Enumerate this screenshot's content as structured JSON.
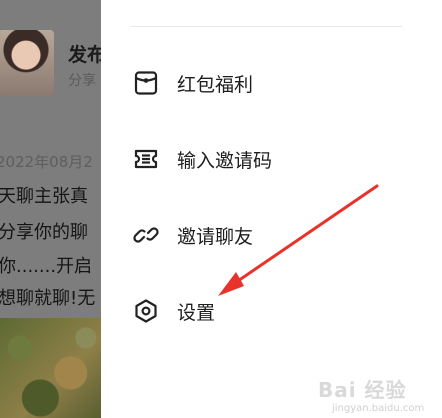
{
  "background": {
    "post_title": "发布",
    "post_subtitle": "分享",
    "date": "2022年08月2",
    "lines": [
      "天聊主张真",
      "分享你的聊",
      "你.......开启",
      "想聊就聊!无"
    ]
  },
  "menu": {
    "items": [
      {
        "label": "红包福利",
        "icon": "red-packet-icon"
      },
      {
        "label": "输入邀请码",
        "icon": "invite-code-icon"
      },
      {
        "label": "邀请聊友",
        "icon": "link-icon"
      },
      {
        "label": "设置",
        "icon": "gear-hexagon-icon"
      }
    ]
  },
  "annotation": {
    "arrow_color": "#e8322a"
  },
  "watermark": {
    "main": "Bai 经验",
    "sub": "jingyan.baidu.com"
  }
}
